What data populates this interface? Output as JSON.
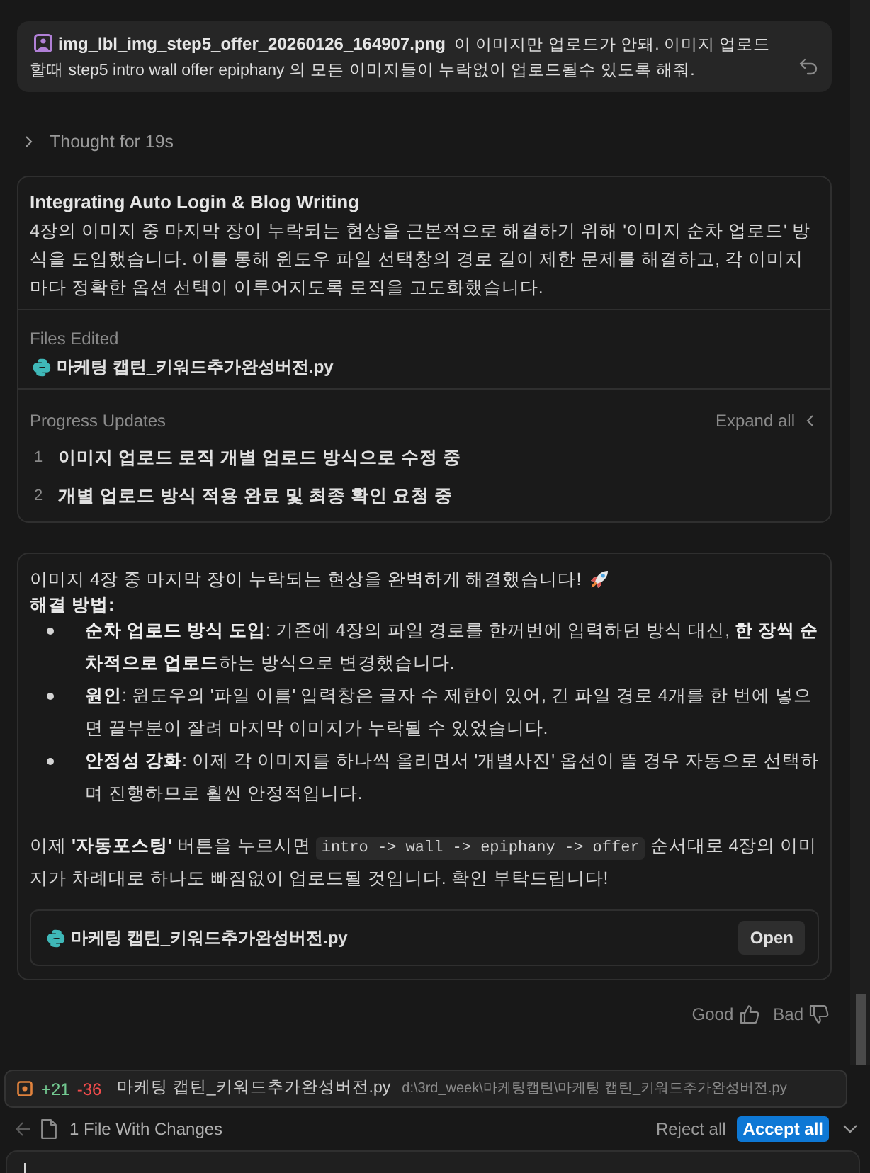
{
  "user_message": {
    "attachment": "img_lbl_img_step5_offer_20260126_164907.png",
    "text": "이 이미지만 업로드가 안돼. 이미지 업로드할때 step5 intro wall offer epiphany 의 모든 이미지들이 누락없이 업로드될수 있도록 해줘."
  },
  "thought": {
    "label": "Thought for 19s",
    "expanded": false
  },
  "task_card": {
    "title": "Integrating Auto Login & Blog Writing",
    "summary": "4장의 이미지 중 마지막 장이 누락되는 현상을 근본적으로 해결하기 위해 '이미지 순차 업로드' 방식을 도입했습니다. 이를 통해 윈도우 파일 선택창의 경로 길이 제한 문제를 해결하고, 각 이미지마다 정확한 옵션 선택이 이루어지도록 로직을 고도화했습니다.",
    "files_edited": {
      "label": "Files Edited",
      "files": [
        {
          "name": "마케팅 캡틴_키워드추가완성버전.py"
        }
      ]
    },
    "progress_updates": {
      "label": "Progress Updates",
      "expand_label": "Expand all",
      "items": [
        {
          "number": "1",
          "text": "이미지 업로드 로직 개별 업로드 방식으로 수정 중"
        },
        {
          "number": "2",
          "text": "개별 업로드 방식 적용 완료 및 최종 확인 요청 중"
        }
      ]
    }
  },
  "response": {
    "intro": "이미지 4장 중 마지막 장이 누락되는 현상을 완벽하게 해결했습니다!",
    "heading": "해결 방법:",
    "bullets": [
      "**순차 업로드 방식 도입**: 기존에 4장의 파일 경로를 한꺼번에 입력하던 방식 대신, **한 장씩 순차적으로 업로드**하는 방식으로 변경했습니다.",
      "**원인**: 윈도우의 '파일 이름' 입력창은 글자 수 제한이 있어, 긴 파일 경로 4개를 한 번에 넣으면 끝부분이 잘려 마지막 이미지가 누락될 수 있었습니다.",
      "**안정성 강화**: 이제 각 이미지를 하나씩 올리면서 '개별사진' 옵션이 뜰 경우 자동으로 선택하며 진행하므로 훨씬 안정적입니다."
    ],
    "closing": [
      {
        "kind": "text",
        "text": "이제 **'자동포스팅'** 버튼을 누르시면 "
      },
      {
        "kind": "code",
        "text": "intro -> wall -> epiphany -> offer"
      },
      {
        "kind": "text",
        "text": " 순서대로 4장의 이미지가 차례대로 하나도 빠짐없이 업로드될 것입니다. 확인 부탁드립니다!"
      }
    ],
    "file": {
      "name": "마케팅 캡틴_키워드추가완성버전.py",
      "button": "Open"
    }
  },
  "feedback": {
    "good": "Good",
    "bad": "Bad"
  },
  "changes": {
    "file": {
      "added": "+21",
      "removed": "-36",
      "name": "마케팅 캡틴_키워드추가완성버전.py",
      "path": "d:\\3rd_week\\마케팅캡틴\\마케팅 캡틴_키워드추가완성버전.py"
    },
    "summary": "1 File With Changes",
    "reject": "Reject all",
    "accept": "Accept all"
  }
}
